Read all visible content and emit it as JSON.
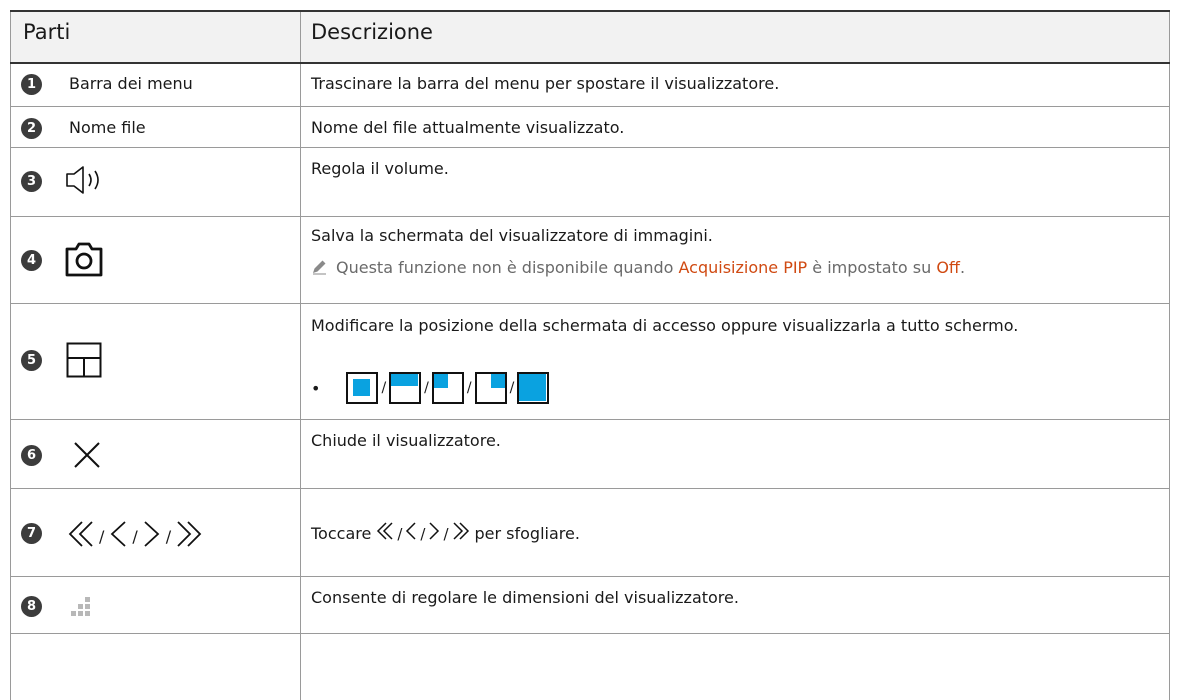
{
  "table": {
    "header_parts": "Parti",
    "header_description": "Descrizione",
    "rows": [
      {
        "num": "1",
        "part": "Barra dei menu",
        "description": "Trascinare la barra del menu per spostare il visualizzatore."
      },
      {
        "num": "2",
        "part": "Nome file",
        "description": "Nome del file attualmente visualizzato."
      },
      {
        "num": "3",
        "part_icon": "volume-icon",
        "description": "Regola il volume."
      },
      {
        "num": "4",
        "part_icon": "camera-icon",
        "description": "Salva la schermata del visualizzatore di immagini.",
        "note_pre": "Questa funzione non è disponibile quando ",
        "note_hl1": "Acquisizione PIP",
        "note_mid": " è impostato su ",
        "note_hl2": "Off",
        "note_post": "."
      },
      {
        "num": "5",
        "part_icon": "layout-icon",
        "description": "Modificare la posizione della schermata di accesso oppure visualizzarla a tutto schermo.",
        "bullet": "•",
        "separator": "/",
        "modes": [
          "center-mode-icon",
          "top-half-mode-icon",
          "top-left-mode-icon",
          "top-right-mode-icon",
          "fullscreen-mode-icon"
        ]
      },
      {
        "num": "6",
        "part_icon": "close-icon",
        "description": "Chiude il visualizzatore."
      },
      {
        "num": "7",
        "part_icons": [
          "first-page-icon",
          "previous-page-icon",
          "next-page-icon",
          "last-page-icon"
        ],
        "separator": "/",
        "desc_pre": "Toccare",
        "desc_post": "per sfogliare."
      },
      {
        "num": "8",
        "part_icon": "resize-handle-icon",
        "description": "Consente di regolare le dimensioni del visualizzatore."
      }
    ]
  },
  "colors": {
    "highlight": "#d04a12",
    "accent_blue": "#0aa2e0",
    "header_bg": "#f2f2f2",
    "badge": "#3c3c3c"
  }
}
